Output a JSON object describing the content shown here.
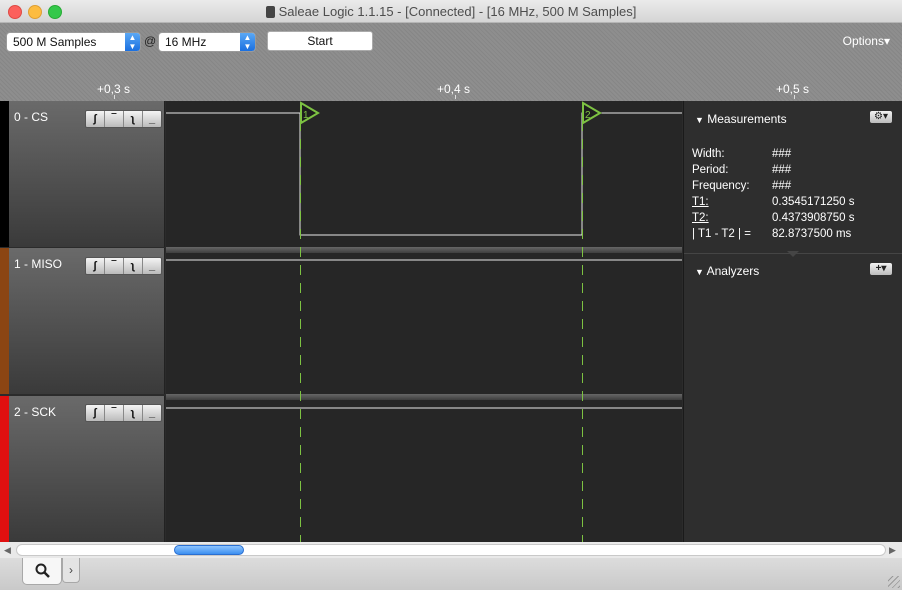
{
  "window": {
    "title": "Saleae Logic 1.1.15 - [Connected] - [16 MHz, 500 M Samples]"
  },
  "toolbar": {
    "samples_value": "500 M Samples",
    "at_sign": "@",
    "rate_value": "16 MHz",
    "start_label": "Start",
    "options_label": "Options▾"
  },
  "timeline": {
    "ticks": [
      "+0,3 s",
      "+0,4 s",
      "+0,5 s"
    ]
  },
  "channels": [
    {
      "name": "0 - CS",
      "color": "#000000"
    },
    {
      "name": "1 - MISO",
      "color": "#8b4513"
    },
    {
      "name": "2 - SCK",
      "color": "#e01010"
    }
  ],
  "trigger_buttons": [
    "ʃ",
    "‾",
    "ʅ",
    "_"
  ],
  "markers": {
    "marker1": "1",
    "marker2": "2",
    "color": "#7dc242"
  },
  "measurements": {
    "header": "Measurements",
    "rows": [
      {
        "label": "Width:",
        "value": "###"
      },
      {
        "label": "Period:",
        "value": "###"
      },
      {
        "label": "Frequency:",
        "value": "###"
      },
      {
        "label": "T1:",
        "value": "0.3545171250 s"
      },
      {
        "label": "T2:",
        "value": "0.4373908750 s"
      },
      {
        "label": "| T1 - T2 | =",
        "value": "82.8737500 ms"
      }
    ]
  },
  "analyzers": {
    "header": "Analyzers",
    "add_label": "+▾"
  },
  "gear_label": "⚙▾"
}
